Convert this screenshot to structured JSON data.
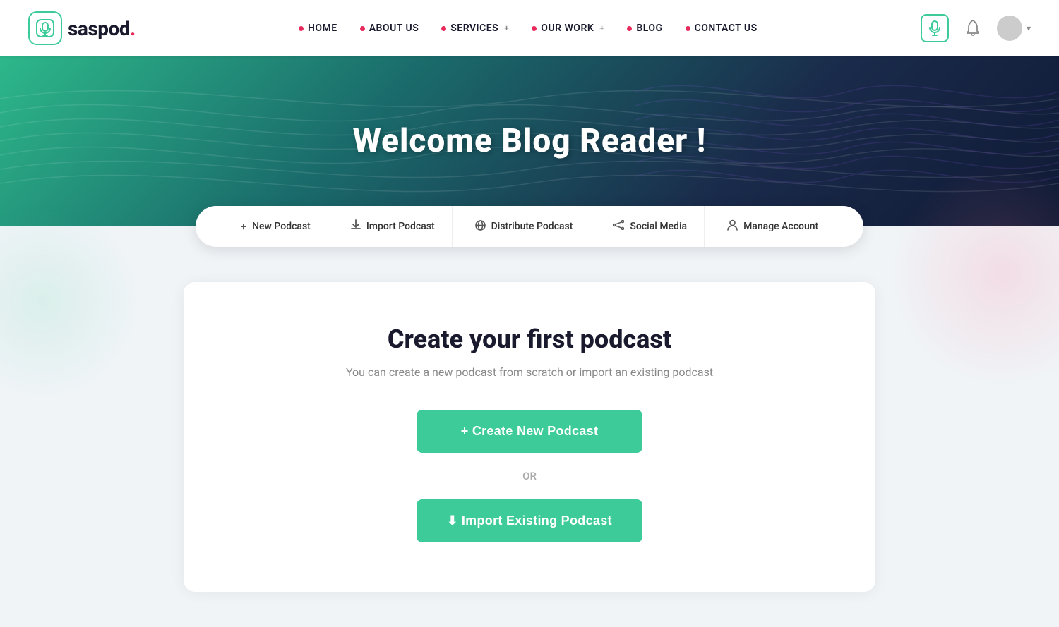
{
  "brand": {
    "name": "saspod",
    "dot": "."
  },
  "nav": {
    "items": [
      {
        "label": "HOME",
        "has_plus": false
      },
      {
        "label": "ABOUT US",
        "has_plus": false
      },
      {
        "label": "SERVICES",
        "has_plus": true
      },
      {
        "label": "OUR WORK",
        "has_plus": true
      },
      {
        "label": "BLOG",
        "has_plus": false
      },
      {
        "label": "CONTACT US",
        "has_plus": false
      }
    ]
  },
  "hero": {
    "title": "Welcome Blog Reader !"
  },
  "action_bar": {
    "items": [
      {
        "icon": "+",
        "label": "New Podcast"
      },
      {
        "icon": "⬇",
        "label": "Import Podcast"
      },
      {
        "icon": "🌐",
        "label": "Distribute Podcast"
      },
      {
        "icon": "⬡",
        "label": "Social Media"
      },
      {
        "icon": "👤",
        "label": "Manage Account"
      }
    ]
  },
  "main_card": {
    "title": "Create your first podcast",
    "subtitle": "You can create a new podcast from scratch or import an existing podcast",
    "create_btn": "+ Create New Podcast",
    "or_label": "OR",
    "import_btn": "⬇ Import Existing Podcast"
  }
}
